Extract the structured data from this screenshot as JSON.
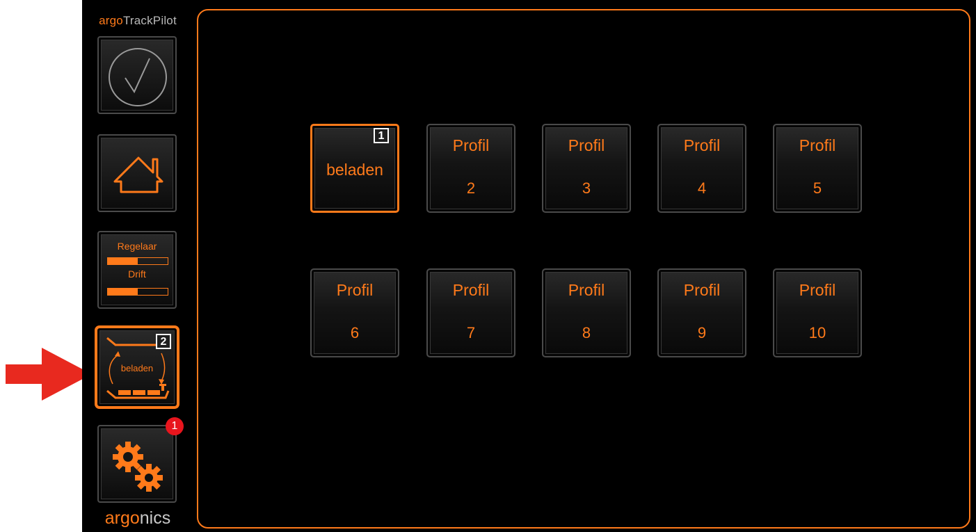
{
  "brand": {
    "top_a": "argo",
    "top_b": "TrackPilot",
    "bottom_a": "argo",
    "bottom_b": "nics"
  },
  "sidebar": {
    "check_button": {
      "icon": "check-circle-icon"
    },
    "home_button": {
      "icon": "home-icon"
    },
    "regulator_button": {
      "regelaar_label": "Regelaar",
      "regelaar_level": 0.5,
      "drift_label": "Drift",
      "drift_level": 0.5
    },
    "load_profile_button": {
      "label": "beladen",
      "icon": "ship-load-icon",
      "badge": "2"
    },
    "settings_button": {
      "icon": "gears-icon",
      "notification_count": "1"
    }
  },
  "annotation": {
    "arrow_color": "#e8291f"
  },
  "profiles": [
    {
      "title": "",
      "name": "beladen",
      "number": "",
      "badge": "1",
      "selected": true
    },
    {
      "title": "Profil",
      "number": "2"
    },
    {
      "title": "Profil",
      "number": "3"
    },
    {
      "title": "Profil",
      "number": "4"
    },
    {
      "title": "Profil",
      "number": "5"
    },
    {
      "title": "Profil",
      "number": "6"
    },
    {
      "title": "Profil",
      "number": "7"
    },
    {
      "title": "Profil",
      "number": "8"
    },
    {
      "title": "Profil",
      "number": "9"
    },
    {
      "title": "Profil",
      "number": "10"
    }
  ],
  "colors": {
    "accent": "#ff7a1a",
    "background": "#000000",
    "alert": "#e8151d"
  }
}
